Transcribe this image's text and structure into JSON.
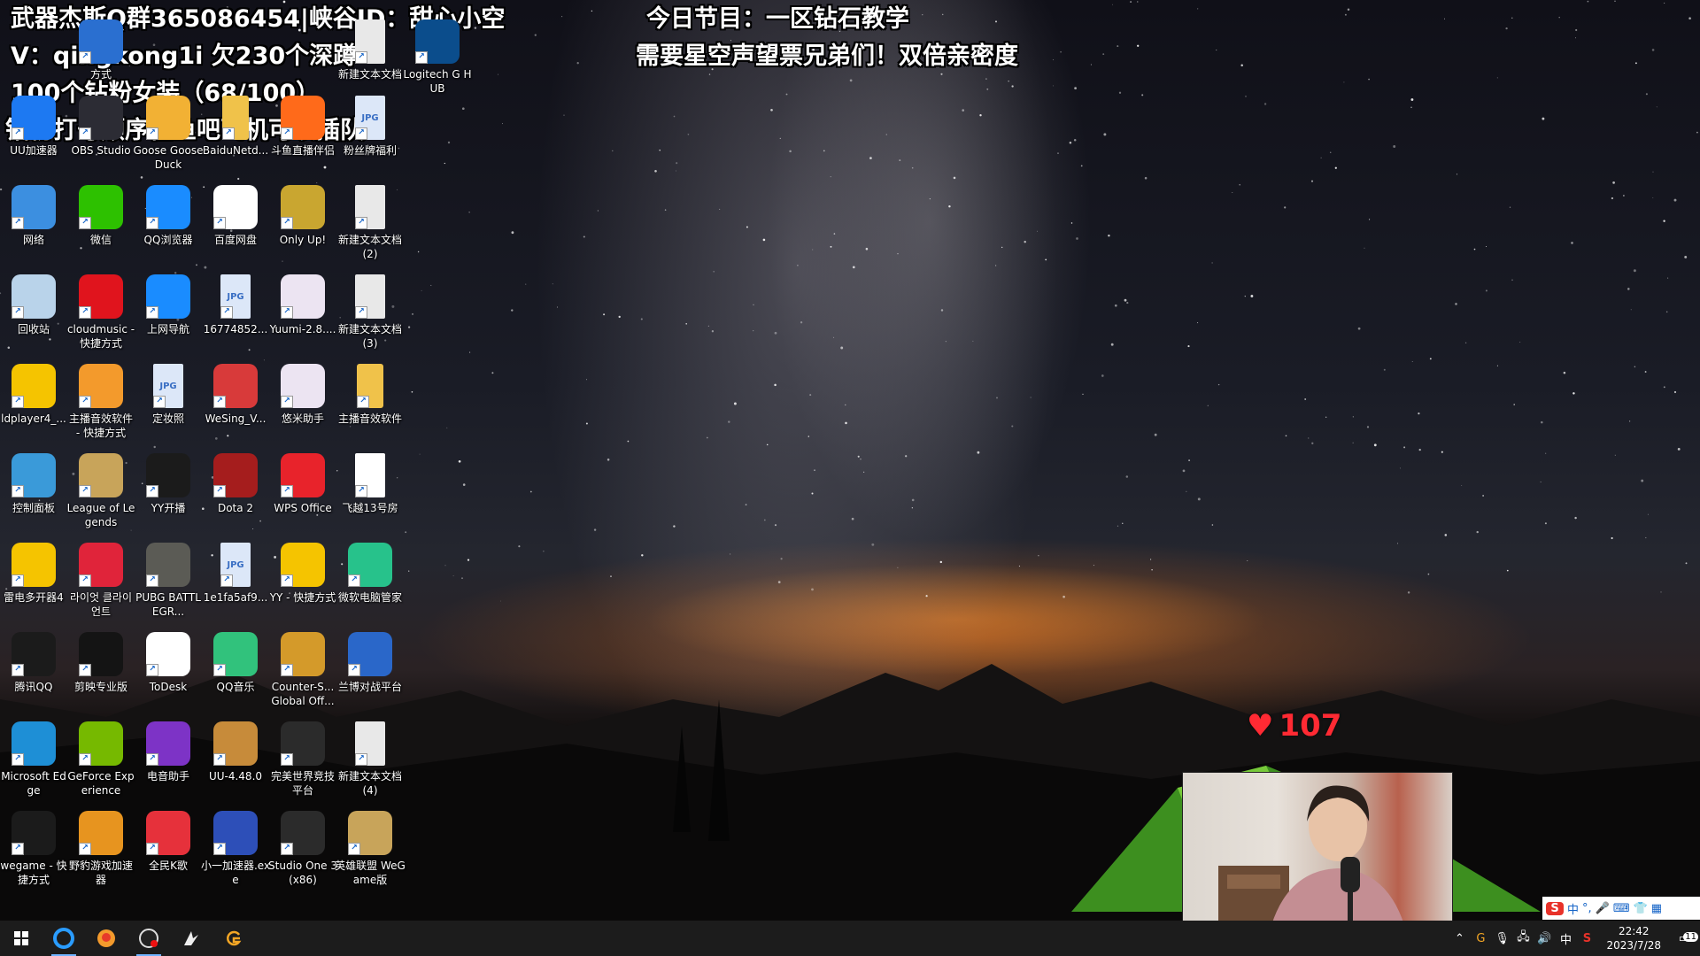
{
  "overlay": {
    "line1": "武器杰斯Q群365086454|峡谷ID：甜心小空",
    "line2": "V：qingkong1i  欠230个深蹲",
    "line3": "100个钻粉女装（68/100）",
    "line4": "钻粉打号顺序在鱼吧飞机可以插队",
    "program1": "今日节目：一区钻石教学",
    "program2": "需要星空声望票兄弟们！双倍亲密度"
  },
  "heart_count": "107",
  "desktop_icons": [
    {
      "label": "方式",
      "icon": "shortcut-icon",
      "color": "#2a6fd0"
    },
    {
      "label": "新建文本文档",
      "icon": "text-file-icon",
      "color": "#e8e8e8"
    },
    {
      "label": "Logitech G HUB",
      "icon": "logitech-icon",
      "color": "#0b4d8c"
    },
    {
      "label": "UU加速器",
      "icon": "uu-booster-icon",
      "color": "#1d79f2"
    },
    {
      "label": "OBS Studio",
      "icon": "obs-icon",
      "color": "#2c2c34"
    },
    {
      "label": "Goose Goose Duck",
      "icon": "goose-icon",
      "color": "#f2b134"
    },
    {
      "label": "BaiduNetd...",
      "icon": "folder-icon",
      "color": "#f0c24a"
    },
    {
      "label": "斗鱼直播伴侣",
      "icon": "douyu-icon",
      "color": "#ff6a1a"
    },
    {
      "label": "粉丝牌福利",
      "icon": "jpg-file-icon",
      "color": "#dce7f8"
    },
    {
      "label": "网络",
      "icon": "network-icon",
      "color": "#3c8fe0"
    },
    {
      "label": "微信",
      "icon": "wechat-icon",
      "color": "#2dc100"
    },
    {
      "label": "QQ浏览器",
      "icon": "qq-browser-icon",
      "color": "#1a8cff"
    },
    {
      "label": "百度网盘",
      "icon": "baidu-netdisk-icon",
      "color": "#ffffff"
    },
    {
      "label": "Only Up!",
      "icon": "only-up-icon",
      "color": "#c9a630"
    },
    {
      "label": "新建文本文档 (2)",
      "icon": "text-file-icon",
      "color": "#e8e8e8"
    },
    {
      "label": "回收站",
      "icon": "recycle-bin-icon",
      "color": "#b9d3ea"
    },
    {
      "label": "cloudmusic - 快捷方式",
      "icon": "netease-music-icon",
      "color": "#e0141d"
    },
    {
      "label": "上网导航",
      "icon": "ie-icon",
      "color": "#1a8cff"
    },
    {
      "label": "16774852...",
      "icon": "jpg-file-icon",
      "color": "#dce7f8"
    },
    {
      "label": "Yuumi-2.8....",
      "icon": "yuumi-icon",
      "color": "#ece4f2"
    },
    {
      "label": "新建文本文档 (3)",
      "icon": "text-file-icon",
      "color": "#e8e8e8"
    },
    {
      "label": "ldplayer4_...",
      "icon": "ldplayer-icon",
      "color": "#f5c400"
    },
    {
      "label": "主播音效软件 - 快捷方式",
      "icon": "sound-effect-icon",
      "color": "#f39a2c"
    },
    {
      "label": "定妆照",
      "icon": "jpg-file-icon",
      "color": "#dce7f8"
    },
    {
      "label": "WeSing_V...",
      "icon": "wesing-icon",
      "color": "#d83a3a"
    },
    {
      "label": "悠米助手",
      "icon": "yuumi-helper-icon",
      "color": "#ece4f2"
    },
    {
      "label": "主播音效软件",
      "icon": "folder-icon",
      "color": "#f0c24a"
    },
    {
      "label": "控制面板",
      "icon": "control-panel-icon",
      "color": "#3a9ad9"
    },
    {
      "label": "League of Legends",
      "icon": "league-icon",
      "color": "#c8a45a"
    },
    {
      "label": "YY开播",
      "icon": "yy-live-icon",
      "color": "#1b1b1b"
    },
    {
      "label": "Dota 2",
      "icon": "dota-icon",
      "color": "#a51d1d"
    },
    {
      "label": "WPS Office",
      "icon": "wps-icon",
      "color": "#e8232b"
    },
    {
      "label": "飞越13号房",
      "icon": "file-icon",
      "color": "#ffffff"
    },
    {
      "label": "雷电多开器4",
      "icon": "ldmulti-icon",
      "color": "#f5c400"
    },
    {
      "label": "라이엇 클라이언트",
      "icon": "riot-icon",
      "color": "#e0243a"
    },
    {
      "label": "PUBG BATTLEGR...",
      "icon": "pubg-icon",
      "color": "#5b5b55"
    },
    {
      "label": "1e1fa5af9...",
      "icon": "jpg-file-icon",
      "color": "#dce7f8"
    },
    {
      "label": "YY - 快捷方式",
      "icon": "yy-icon",
      "color": "#f5c400"
    },
    {
      "label": "微软电脑管家",
      "icon": "pc-manager-icon",
      "color": "#27c28b"
    },
    {
      "label": "腾讯QQ",
      "icon": "qq-icon",
      "color": "#1b1b1b"
    },
    {
      "label": "剪映专业版",
      "icon": "capcut-icon",
      "color": "#141414"
    },
    {
      "label": "ToDesk",
      "icon": "todesk-icon",
      "color": "#ffffff"
    },
    {
      "label": "QQ音乐",
      "icon": "qq-music-icon",
      "color": "#31c27c"
    },
    {
      "label": "Counter-S... Global Off...",
      "icon": "csgo-icon",
      "color": "#d49a2a"
    },
    {
      "label": "兰博对战平台",
      "icon": "lanbo-icon",
      "color": "#2a67c9"
    },
    {
      "label": "Microsoft Edge",
      "icon": "edge-icon",
      "color": "#1e8fd6"
    },
    {
      "label": "GeForce Experience",
      "icon": "nvidia-icon",
      "color": "#76b900"
    },
    {
      "label": "电音助手",
      "icon": "search-magnifier-icon",
      "color": "#7d33c6"
    },
    {
      "label": "UU-4.48.0",
      "icon": "install-box-icon",
      "color": "#c78b3a"
    },
    {
      "label": "完美世界竞技平台",
      "icon": "perfect-world-icon",
      "color": "#2b2b2b"
    },
    {
      "label": "新建文本文档 (4)",
      "icon": "text-file-icon",
      "color": "#e8e8e8"
    },
    {
      "label": "wegame - 快捷方式",
      "icon": "wegame-icon",
      "color": "#1b1b1b"
    },
    {
      "label": "野豹游戏加速器",
      "icon": "leopard-icon",
      "color": "#e7941f"
    },
    {
      "label": "全民K歌",
      "icon": "kge-icon",
      "color": "#e6313b"
    },
    {
      "label": "小一加速器.exe",
      "icon": "xiaoyi-icon",
      "color": "#2d4fb8"
    },
    {
      "label": "Studio One 3 (x86)",
      "icon": "studio-one-icon",
      "color": "#2b2b2b"
    },
    {
      "label": "英雄联盟 WeGame版",
      "icon": "league-wegame-icon",
      "color": "#c8a45a"
    }
  ],
  "taskbar": {
    "apps": [
      {
        "name": "start-button",
        "glyph": "windows-logo"
      },
      {
        "name": "taskbar-qq-browser",
        "glyph": "qq-browser-icon"
      },
      {
        "name": "taskbar-sound-effect",
        "glyph": "sound-effect-icon"
      },
      {
        "name": "taskbar-obs",
        "glyph": "obs-icon"
      },
      {
        "name": "taskbar-studio-one",
        "glyph": "studio-one-icon"
      },
      {
        "name": "taskbar-wegame",
        "glyph": "wegame-icon"
      }
    ],
    "tray": {
      "ime_lang": "中",
      "time": "22:42",
      "date": "2023/7/28",
      "notification_count": "11"
    },
    "ime_bar": {
      "logo": "S",
      "mode": "中"
    }
  }
}
